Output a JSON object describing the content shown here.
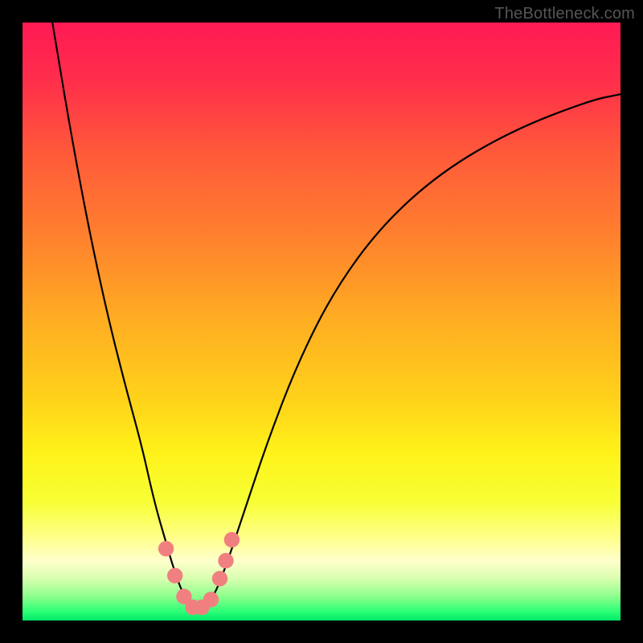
{
  "watermark": "TheBottleneck.com",
  "gradient": {
    "stops": [
      {
        "offset": 0.0,
        "color": "#ff1a55"
      },
      {
        "offset": 0.1,
        "color": "#ff2f4a"
      },
      {
        "offset": 0.22,
        "color": "#ff5a3a"
      },
      {
        "offset": 0.35,
        "color": "#ff7e2e"
      },
      {
        "offset": 0.5,
        "color": "#ffae22"
      },
      {
        "offset": 0.63,
        "color": "#ffd21a"
      },
      {
        "offset": 0.72,
        "color": "#fff21a"
      },
      {
        "offset": 0.8,
        "color": "#f7ff33"
      },
      {
        "offset": 0.86,
        "color": "#ffff88"
      },
      {
        "offset": 0.9,
        "color": "#ffffcc"
      },
      {
        "offset": 0.93,
        "color": "#d8ffb0"
      },
      {
        "offset": 0.96,
        "color": "#8cff8c"
      },
      {
        "offset": 0.985,
        "color": "#2dff76"
      },
      {
        "offset": 1.0,
        "color": "#00e868"
      }
    ]
  },
  "chart_data": {
    "type": "line",
    "title": "",
    "xlabel": "",
    "ylabel": "",
    "xlim": [
      0,
      100
    ],
    "ylim": [
      0,
      100
    ],
    "series": [
      {
        "name": "curve",
        "x": [
          5,
          8,
          11,
          14,
          17,
          20,
          22,
          24,
          25.5,
          27,
          28.5,
          30,
          32,
          34,
          37,
          41,
          46,
          52,
          60,
          70,
          82,
          95,
          100
        ],
        "values": [
          100,
          82,
          66,
          52,
          40,
          29,
          20,
          13,
          8,
          4,
          2,
          2,
          4,
          9,
          18,
          30,
          43,
          55,
          66,
          75,
          82,
          87,
          88
        ]
      }
    ],
    "markers": {
      "name": "highlight-dots",
      "color": "#f08080",
      "radius_plot_units": 1.3,
      "points": [
        {
          "x": 24.0,
          "y": 12.0
        },
        {
          "x": 25.5,
          "y": 7.5
        },
        {
          "x": 27.0,
          "y": 4.0
        },
        {
          "x": 28.5,
          "y": 2.2
        },
        {
          "x": 30.0,
          "y": 2.2
        },
        {
          "x": 31.5,
          "y": 3.5
        },
        {
          "x": 33.0,
          "y": 7.0
        },
        {
          "x": 34.0,
          "y": 10.0
        },
        {
          "x": 35.0,
          "y": 13.5
        }
      ]
    }
  }
}
